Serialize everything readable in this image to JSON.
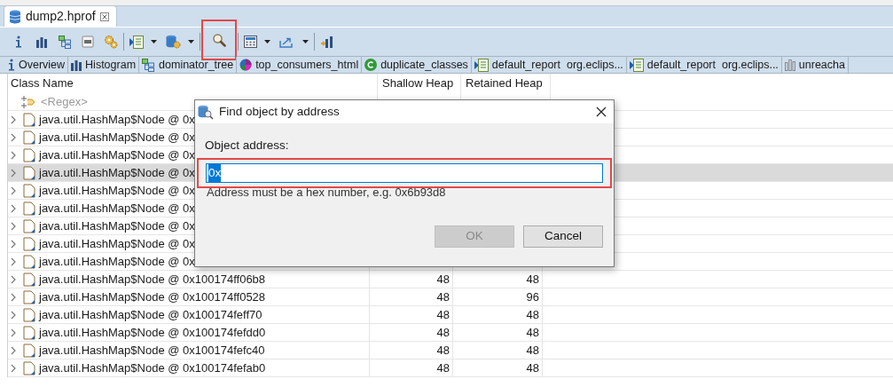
{
  "editor_tab": {
    "title": "dump2.hprof"
  },
  "toolbar": [
    {
      "kind": "info",
      "dropdown": false,
      "highlighted": false
    },
    {
      "kind": "histogram",
      "dropdown": false,
      "highlighted": false
    },
    {
      "kind": "tree",
      "dropdown": false,
      "highlighted": false
    },
    {
      "kind": "oql",
      "dropdown": false,
      "highlighted": false
    },
    {
      "kind": "gear",
      "dropdown": false,
      "highlighted": false,
      "separator_after": true
    },
    {
      "kind": "report",
      "dropdown": true,
      "highlighted": false
    },
    {
      "kind": "db-gear",
      "dropdown": true,
      "highlighted": false,
      "separator_after": true
    },
    {
      "kind": "search",
      "dropdown": false,
      "highlighted": true,
      "separator_after": true
    },
    {
      "kind": "calc",
      "dropdown": true,
      "highlighted": false
    },
    {
      "kind": "export",
      "dropdown": true,
      "highlighted": false,
      "separator_after": true
    },
    {
      "kind": "chart",
      "dropdown": false,
      "highlighted": false
    }
  ],
  "view_tabs": [
    {
      "kind": "info",
      "label": "Overview"
    },
    {
      "kind": "histogram",
      "label": "Histogram"
    },
    {
      "kind": "tree",
      "label": "dominator_tree"
    },
    {
      "kind": "pie",
      "label": "top_consumers_html"
    },
    {
      "kind": "class",
      "label": "duplicate_classes"
    },
    {
      "kind": "report",
      "label": "default_report  org.eclips..."
    },
    {
      "kind": "report",
      "label": "default_report  org.eclips..."
    },
    {
      "kind": "bars",
      "label": "unreacha"
    }
  ],
  "table": {
    "columns": [
      "Class Name",
      "Shallow Heap",
      "Retained Heap"
    ],
    "filter": {
      "placeholder": "<Regex>"
    },
    "rows": [
      {
        "class_name": "java.util.HashMap$Node @ 0x",
        "selected": false
      },
      {
        "class_name": "java.util.HashMap$Node @ 0x",
        "selected": false
      },
      {
        "class_name": "java.util.HashMap$Node @ 0x",
        "selected": false
      },
      {
        "class_name": "java.util.HashMap$Node @ 0x",
        "selected": true
      },
      {
        "class_name": "java.util.HashMap$Node @ 0x",
        "selected": false
      },
      {
        "class_name": "java.util.HashMap$Node @ 0x",
        "selected": false
      },
      {
        "class_name": "java.util.HashMap$Node @ 0x",
        "selected": false
      },
      {
        "class_name": "java.util.HashMap$Node @ 0x",
        "selected": false
      },
      {
        "class_name": "java.util.HashMap$Node @ 0x",
        "selected": false
      },
      {
        "class_name": "java.util.HashMap$Node @ 0x100174ff06b8",
        "shallow_heap": "48",
        "retained_heap": "48",
        "selected": false
      },
      {
        "class_name": "java.util.HashMap$Node @ 0x100174ff0528",
        "shallow_heap": "48",
        "retained_heap": "96",
        "selected": false
      },
      {
        "class_name": "java.util.HashMap$Node @ 0x100174feff70",
        "shallow_heap": "48",
        "retained_heap": "48",
        "selected": false
      },
      {
        "class_name": "java.util.HashMap$Node @ 0x100174fefdd0",
        "shallow_heap": "48",
        "retained_heap": "48",
        "selected": false
      },
      {
        "class_name": "java.util.HashMap$Node @ 0x100174fefc40",
        "shallow_heap": "48",
        "retained_heap": "48",
        "selected": false
      },
      {
        "class_name": "java.util.HashMap$Node @ 0x100174fefab0",
        "shallow_heap": "48",
        "retained_heap": "48",
        "selected": false
      }
    ]
  },
  "dialog": {
    "title": "Find object by address",
    "label": "Object address:",
    "value": "0x",
    "highlighted": true,
    "hint": "Address must be a hex number, e.g. 0x6b93d8",
    "buttons": [
      {
        "label": "OK",
        "disabled": true
      },
      {
        "label": "Cancel",
        "disabled": false
      }
    ]
  }
}
